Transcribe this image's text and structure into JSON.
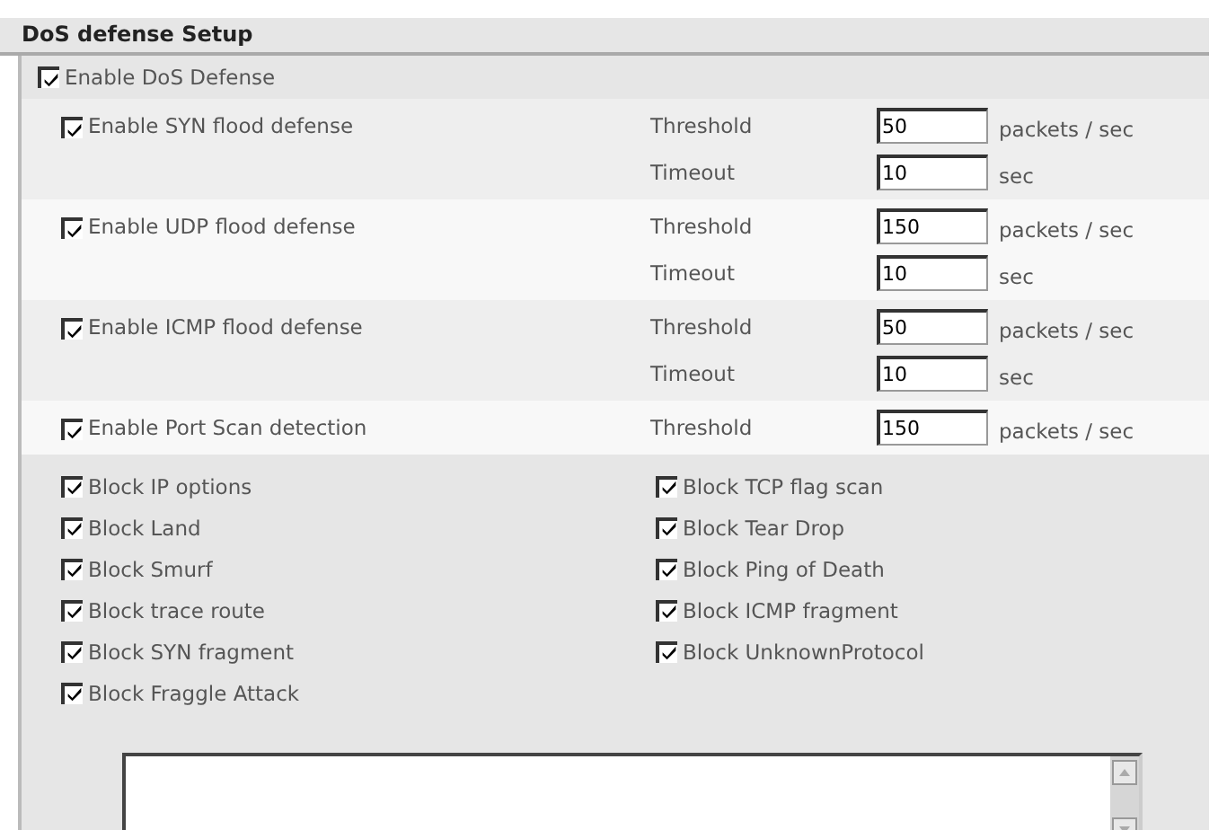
{
  "title": "DoS defense Setup",
  "enable_dos": {
    "label": "Enable DoS Defense",
    "checked": true
  },
  "defenses": [
    {
      "label": "Enable SYN flood defense",
      "checked": true,
      "fields": [
        {
          "label": "Threshold",
          "value": "50",
          "unit": "packets / sec"
        },
        {
          "label": "Timeout",
          "value": "10",
          "unit": "sec"
        }
      ]
    },
    {
      "label": "Enable UDP flood defense",
      "checked": true,
      "fields": [
        {
          "label": "Threshold",
          "value": "150",
          "unit": "packets / sec"
        },
        {
          "label": "Timeout",
          "value": "10",
          "unit": "sec"
        }
      ]
    },
    {
      "label": "Enable ICMP flood defense",
      "checked": true,
      "fields": [
        {
          "label": "Threshold",
          "value": "50",
          "unit": "packets / sec"
        },
        {
          "label": "Timeout",
          "value": "10",
          "unit": "sec"
        }
      ]
    },
    {
      "label": "Enable Port Scan detection",
      "checked": true,
      "fields": [
        {
          "label": "Threshold",
          "value": "150",
          "unit": "packets / sec"
        }
      ]
    }
  ],
  "block_options": [
    {
      "label": "Block IP options",
      "checked": true
    },
    {
      "label": "Block TCP flag scan",
      "checked": true
    },
    {
      "label": "Block Land",
      "checked": true
    },
    {
      "label": "Block Tear Drop",
      "checked": true
    },
    {
      "label": "Block Smurf",
      "checked": true
    },
    {
      "label": "Block Ping of Death",
      "checked": true
    },
    {
      "label": "Block trace route",
      "checked": true
    },
    {
      "label": "Block ICMP fragment",
      "checked": true
    },
    {
      "label": "Block SYN fragment",
      "checked": true
    },
    {
      "label": "Block UnknownProtocol",
      "checked": true
    },
    {
      "label": "Block Fraggle Attack",
      "checked": true
    }
  ]
}
